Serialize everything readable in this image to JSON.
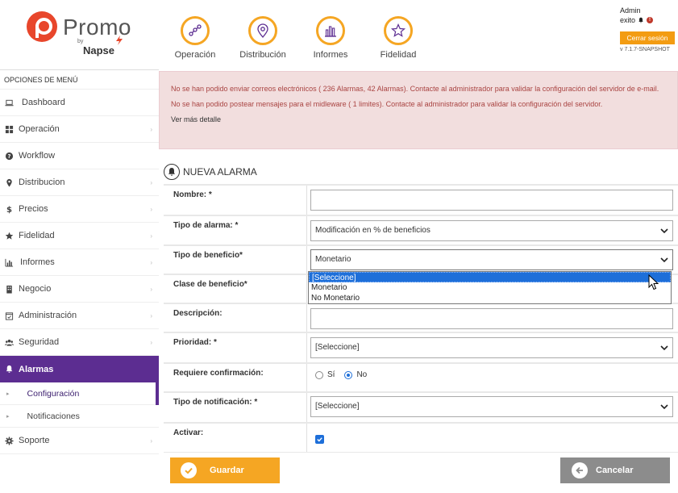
{
  "brand": {
    "name": "Promo",
    "by": "by",
    "company": "Napse"
  },
  "topnav": [
    {
      "label": "Operación",
      "icon": "operation-icon"
    },
    {
      "label": "Distribución",
      "icon": "map-pin-icon"
    },
    {
      "label": "Informes",
      "icon": "bar-chart-icon"
    },
    {
      "label": "Fidelidad",
      "icon": "star-icon"
    }
  ],
  "user": {
    "name": "Admin",
    "status": "exito",
    "logout_label": "Cerrar sesión",
    "version": "v 7.1.7-SNAPSHOT"
  },
  "sidebar": {
    "title": "OPCIONES DE MENÚ",
    "items": [
      {
        "label": "Dashboard"
      },
      {
        "label": "Operación"
      },
      {
        "label": "Workflow"
      },
      {
        "label": "Distribucion"
      },
      {
        "label": "Precios"
      },
      {
        "label": "Fidelidad"
      },
      {
        "label": "Informes"
      },
      {
        "label": "Negocio"
      },
      {
        "label": "Administración"
      },
      {
        "label": "Seguridad"
      },
      {
        "label": "Alarmas"
      },
      {
        "label": "Soporte"
      }
    ],
    "sub_items": [
      {
        "label": "Configuración"
      },
      {
        "label": "Notificaciones"
      }
    ]
  },
  "errors": {
    "line1": "No se han podido enviar correos electrónicos ( 236 Alarmas, 42 Alarmas). Contacte al administrador para validar la configuración del servidor de e-mail.",
    "line2": "No se han podido postear mensajes para el midleware ( 1 limites). Contacte al administrador para validar la configuración del servidor.",
    "more": "Ver más detalle"
  },
  "form": {
    "title": "NUEVA ALARMA",
    "labels": {
      "nombre": "Nombre: *",
      "tipo_alarma": "Tipo de alarma: *",
      "tipo_beneficio": "Tipo de beneficio*",
      "clase_beneficio": "Clase de beneficio*",
      "descripcion": "Descripción:",
      "prioridad": "Prioridad: *",
      "requiere_confirmacion": "Requiere confirmación:",
      "tipo_notificacion": "Tipo de notificación: *",
      "activar": "Activar:"
    },
    "values": {
      "nombre": "",
      "tipo_alarma": "Modificación en % de beneficios",
      "tipo_beneficio": "Monetario",
      "descripcion": "",
      "prioridad": "[Seleccione]",
      "tipo_notificacion": "[Seleccione]"
    },
    "radio": {
      "yes": "Sí",
      "no": "No",
      "selected": "No"
    },
    "activar_checked": true,
    "dropdown_options": [
      "[Seleccione]",
      "Monetario",
      "No Monetario"
    ],
    "save_label": "Guardar",
    "cancel_label": "Cancelar"
  },
  "colors": {
    "accent": "#f5a623",
    "brand": "#e8462b",
    "sidebar_active": "#5c2d91",
    "error_bg": "#f2dede",
    "error_text": "#a94442"
  }
}
